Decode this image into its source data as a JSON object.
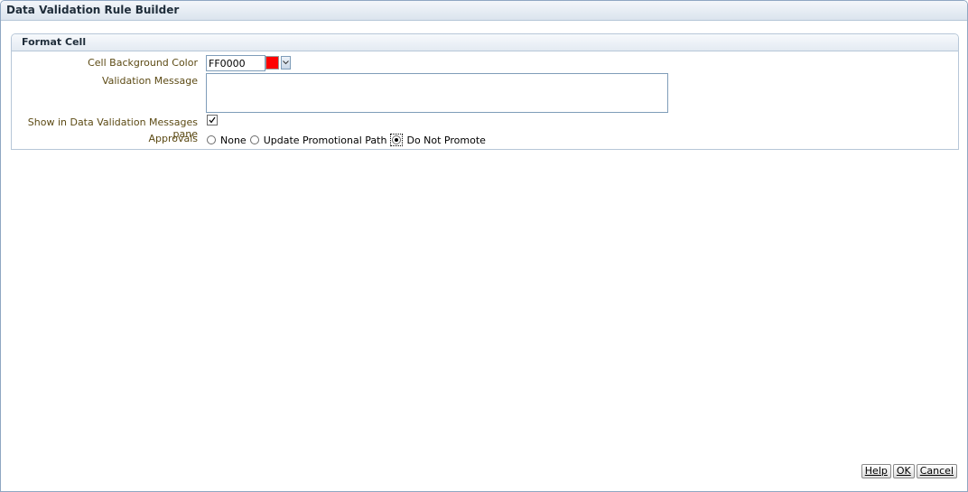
{
  "window": {
    "title": "Data Validation Rule Builder"
  },
  "section": {
    "title": "Format Cell"
  },
  "form": {
    "cell_bg_color_label": "Cell Background Color",
    "cell_bg_color_value": "FF0000",
    "cell_bg_swatch_color": "#ff0000",
    "validation_message_label": "Validation Message",
    "validation_message_value": "",
    "show_in_pane_label": "Show in Data Validation Messages pane",
    "show_in_pane_checked": true,
    "approvals_label": "Approvals",
    "approvals_options": [
      "None",
      "Update Promotional Path",
      "Do Not Promote"
    ],
    "approvals_selected": "Do Not Promote"
  },
  "buttons": {
    "help": "Help",
    "ok": "OK",
    "cancel": "Cancel"
  }
}
